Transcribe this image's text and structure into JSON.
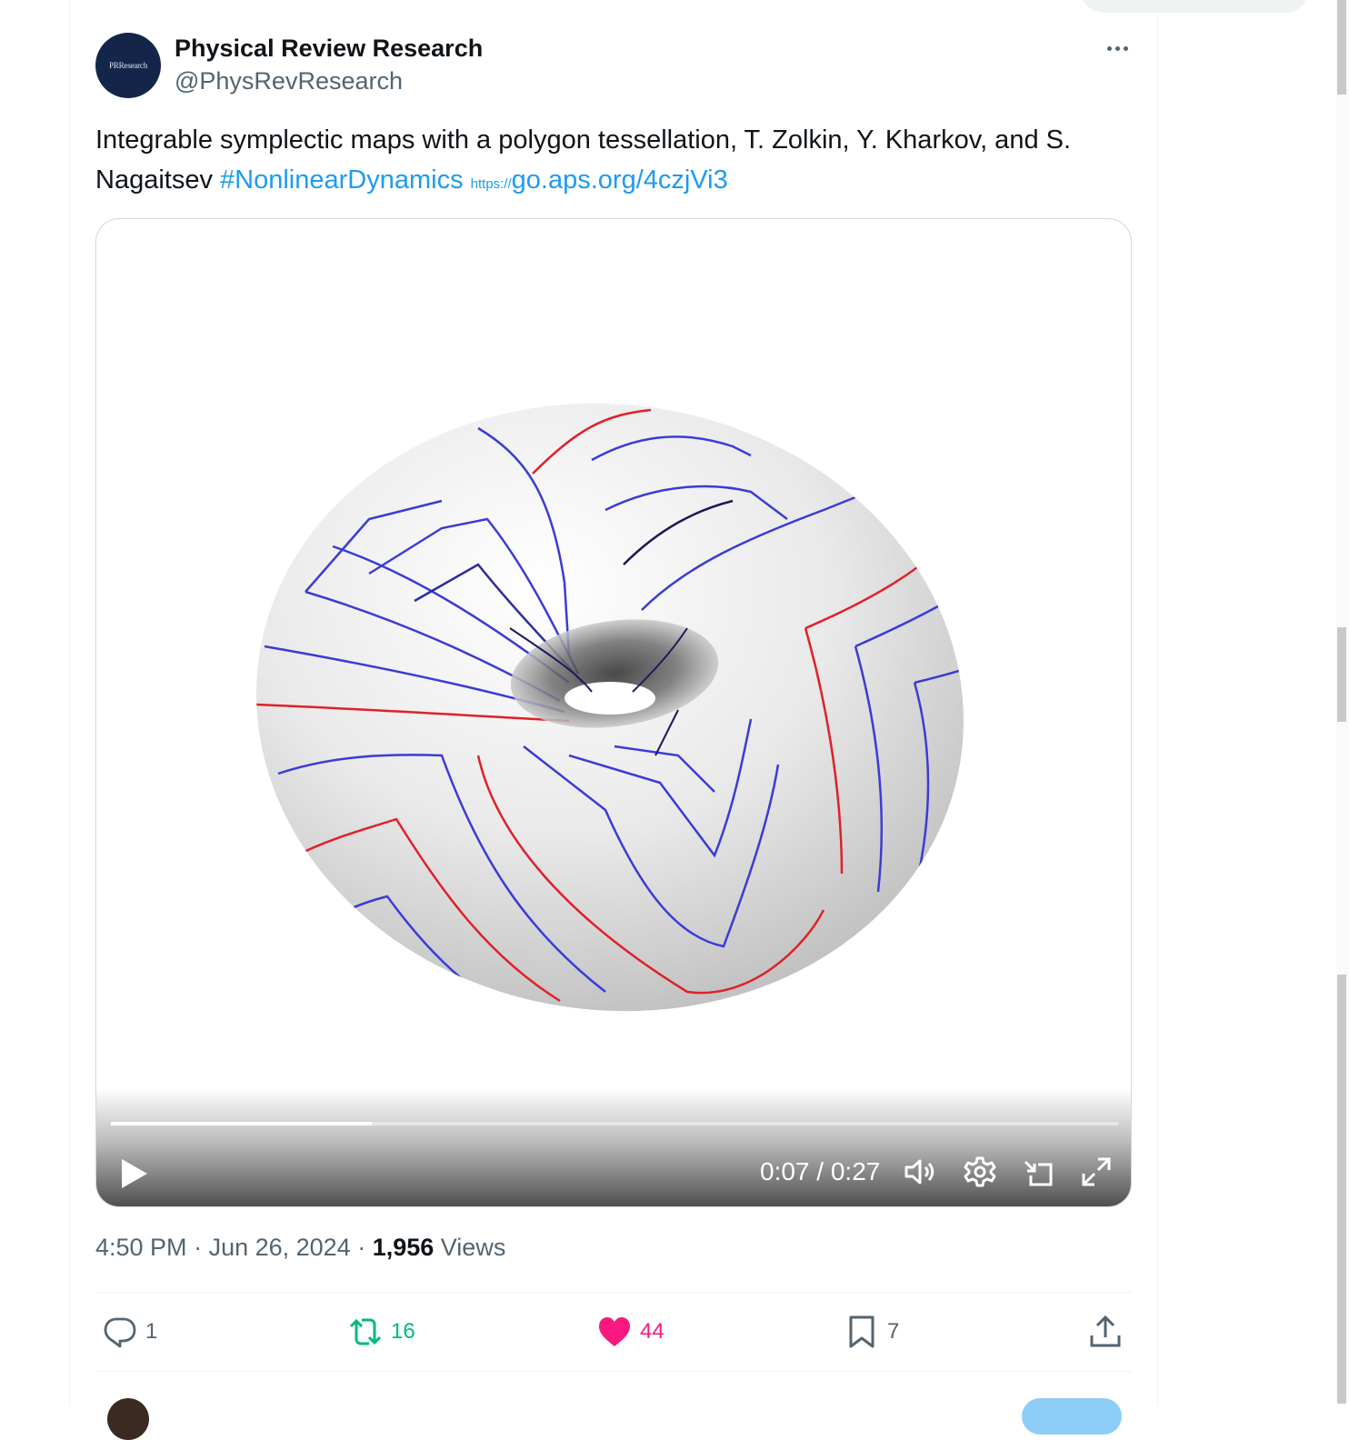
{
  "author": {
    "name": "Physical Review Research",
    "handle": "@PhysRevResearch",
    "avatar_text": "PRResearch"
  },
  "tweet": {
    "text_main": "Integrable symplectic maps with a polygon tessellation, T. Zolkin, Y. Kharkov, and S. Nagaitsev ",
    "hashtag": "#NonlinearDynamics",
    "link_protocol": "https://",
    "link_text": "go.aps.org/4czjVi3"
  },
  "video": {
    "time_current": "0:07",
    "time_separator": " / ",
    "time_total": "0:27",
    "progress_fraction": 0.259
  },
  "meta": {
    "time": "4:50 PM",
    "separator": " · ",
    "date": "Jun 26, 2024",
    "views_count": "1,956",
    "views_label": " Views"
  },
  "actions": {
    "replies": "1",
    "retweets": "16",
    "likes": "44",
    "bookmarks": "7"
  },
  "colors": {
    "accent": "#1d9bf0",
    "retweet": "#00ba7c",
    "like": "#f91880",
    "secondary_text": "#536471"
  },
  "icons": [
    "more-icon",
    "play-icon",
    "volume-icon",
    "settings-gear-icon",
    "minimize-player-icon",
    "fullscreen-icon",
    "reply-icon",
    "retweet-icon",
    "heart-icon",
    "bookmark-icon",
    "share-icon"
  ]
}
